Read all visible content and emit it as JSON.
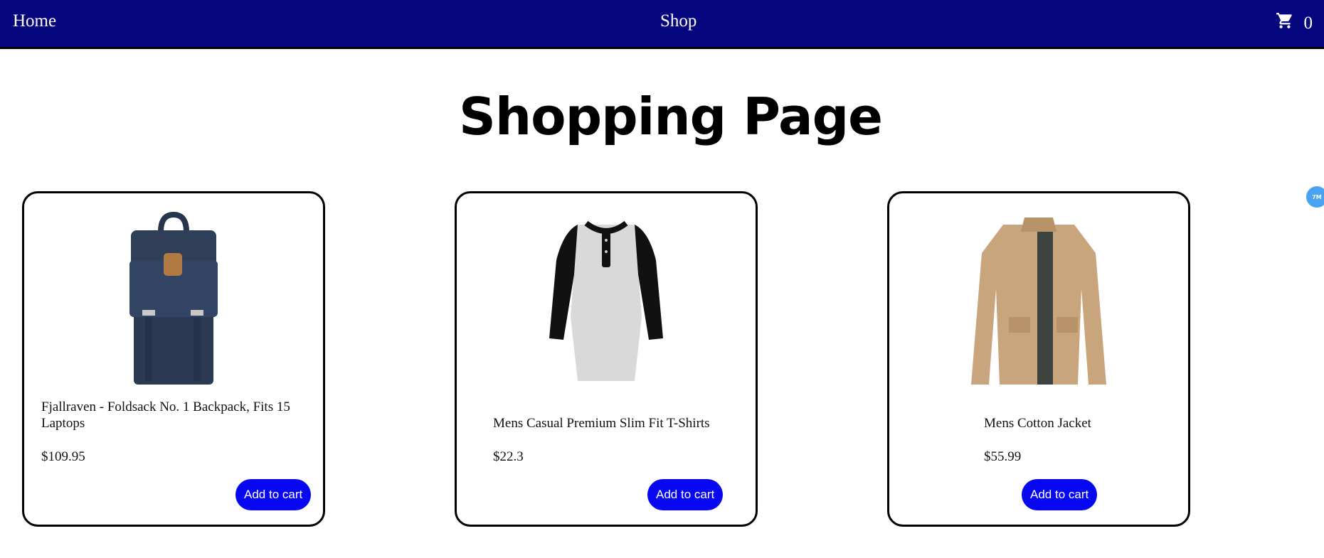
{
  "nav": {
    "home": "Home",
    "shop": "Shop",
    "cart_count": "0",
    "cart_icon": "cart-icon"
  },
  "page_title": "Shopping Page",
  "products": [
    {
      "title": "Fjallraven - Foldsack No. 1 Backpack, Fits 15 Laptops",
      "price": "$109.95",
      "button": "Add to cart",
      "image": "backpack"
    },
    {
      "title": "Mens Casual Premium Slim Fit T-Shirts",
      "price": "$22.3",
      "button": "Add to cart",
      "image": "t-shirt"
    },
    {
      "title": "Mens Cotton Jacket",
      "price": "$55.99",
      "button": "Add to cart",
      "image": "jacket"
    }
  ],
  "badge": "7M",
  "colors": {
    "nav_bg": "#06067f",
    "button_bg": "#0707f2",
    "badge": "#4aa3f2"
  }
}
